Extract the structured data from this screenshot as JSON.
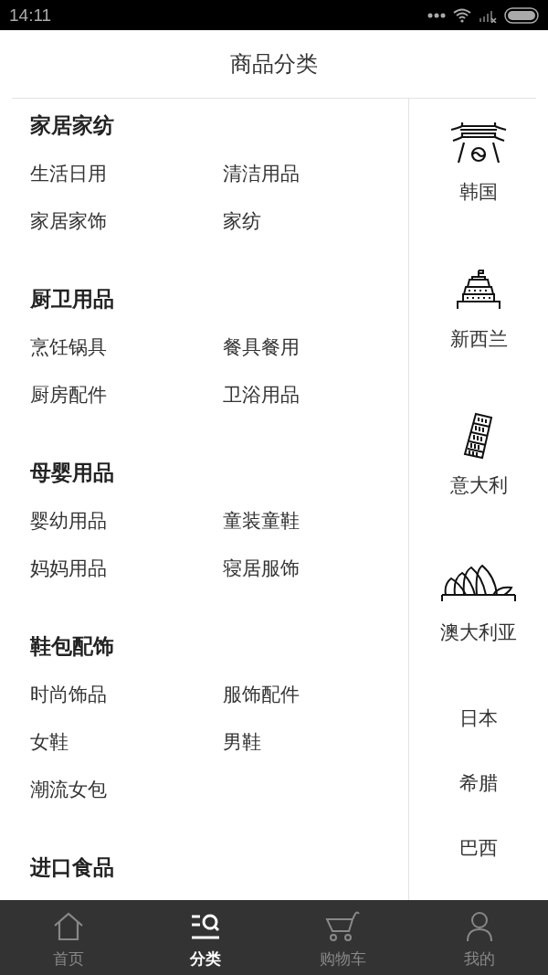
{
  "status_bar": {
    "time": "14:11"
  },
  "header": {
    "title": "商品分类"
  },
  "categories": [
    {
      "title": "家居家纺",
      "items": [
        "生活日用",
        "清洁用品",
        "家居家饰",
        "家纺"
      ]
    },
    {
      "title": "厨卫用品",
      "items": [
        "烹饪锅具",
        "餐具餐用",
        "厨房配件",
        "卫浴用品"
      ]
    },
    {
      "title": "母婴用品",
      "items": [
        "婴幼用品",
        "童装童鞋",
        "妈妈用品",
        "寝居服饰"
      ]
    },
    {
      "title": "鞋包配饰",
      "items": [
        "时尚饰品",
        "服饰配件",
        "女鞋",
        "男鞋",
        "潮流女包"
      ]
    },
    {
      "title": "进口食品"
    }
  ],
  "countries": [
    {
      "label": "韩国",
      "kind": "gate"
    },
    {
      "label": "新西兰",
      "kind": "tower"
    },
    {
      "label": "意大利",
      "kind": "pisa"
    },
    {
      "label": "澳大利亚",
      "kind": "opera"
    },
    {
      "label": "日本",
      "kind": "text"
    },
    {
      "label": "希腊",
      "kind": "text"
    },
    {
      "label": "巴西",
      "kind": "text"
    }
  ],
  "tabs": [
    {
      "label": "首页",
      "kind": "home",
      "selected": false
    },
    {
      "label": "分类",
      "kind": "category",
      "selected": true
    },
    {
      "label": "购物车",
      "kind": "cart",
      "selected": false
    },
    {
      "label": "我的",
      "kind": "user",
      "selected": false
    }
  ]
}
